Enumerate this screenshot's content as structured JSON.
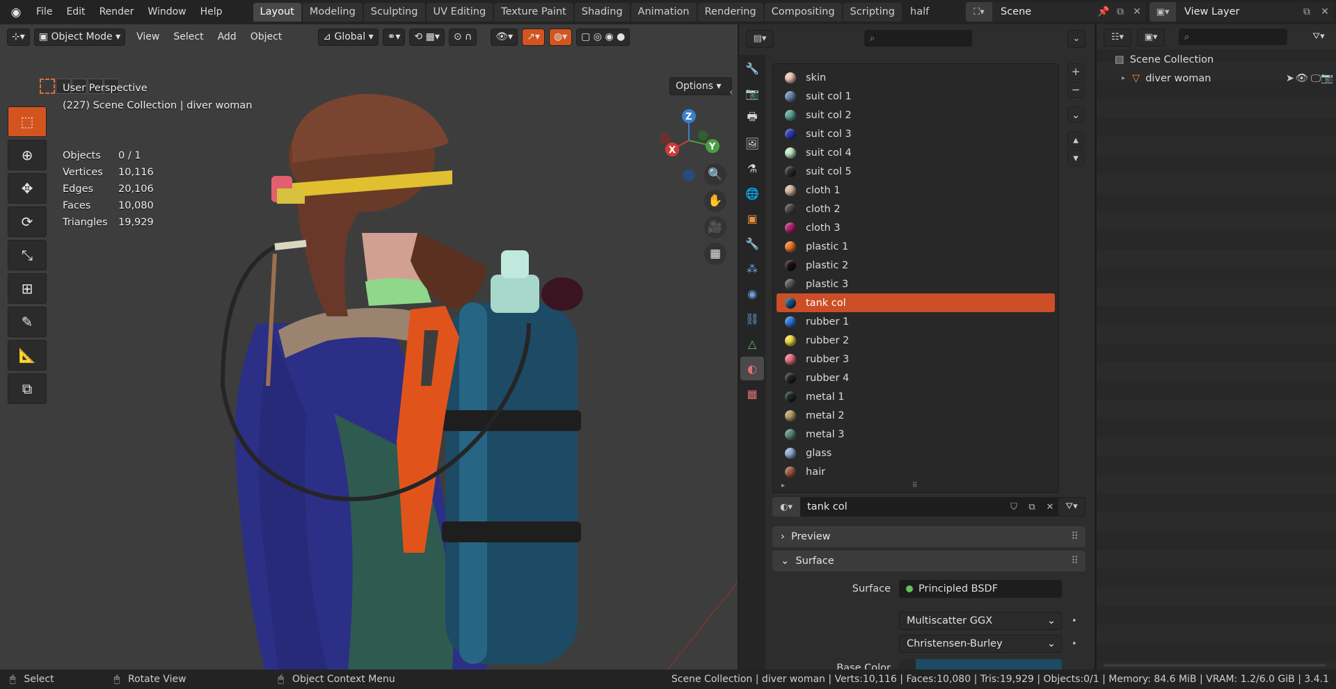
{
  "menu": [
    "File",
    "Edit",
    "Render",
    "Window",
    "Help"
  ],
  "workspaces": [
    "Layout",
    "Modeling",
    "Sculpting",
    "UV Editing",
    "Texture Paint",
    "Shading",
    "Animation",
    "Rendering",
    "Compositing",
    "Scripting",
    "half"
  ],
  "active_workspace": "Layout",
  "scene": {
    "name": "Scene"
  },
  "view_layer": {
    "name": "View Layer"
  },
  "viewport": {
    "mode": "Object Mode",
    "menus": [
      "View",
      "Select",
      "Add",
      "Object"
    ],
    "orientation": "Global",
    "options_label": "Options",
    "view_name": "User Perspective",
    "collection_info": "(227) Scene Collection | diver woman",
    "stats": [
      {
        "label": "Objects",
        "value": "0 / 1"
      },
      {
        "label": "Vertices",
        "value": "10,116"
      },
      {
        "label": "Edges",
        "value": "20,106"
      },
      {
        "label": "Faces",
        "value": "10,080"
      },
      {
        "label": "Triangles",
        "value": "19,929"
      }
    ],
    "gizmo": {
      "x": "X",
      "y": "Y",
      "z": "Z"
    }
  },
  "materials": {
    "slots": [
      {
        "name": "skin",
        "color": "#f0c9b8"
      },
      {
        "name": "suit col 1",
        "color": "#6a87b2"
      },
      {
        "name": "suit col 2",
        "color": "#5aa79a"
      },
      {
        "name": "suit col 3",
        "color": "#2a3bb0"
      },
      {
        "name": "suit col 4",
        "color": "#bfeec8"
      },
      {
        "name": "suit col 5",
        "color": "#2a2a2a"
      },
      {
        "name": "cloth 1",
        "color": "#d8bca0"
      },
      {
        "name": "cloth 2",
        "color": "#444444"
      },
      {
        "name": "cloth 3",
        "color": "#b0206a"
      },
      {
        "name": "plastic 1",
        "color": "#f07a22"
      },
      {
        "name": "plastic 2",
        "color": "#1e1010"
      },
      {
        "name": "plastic 3",
        "color": "#555555"
      },
      {
        "name": "tank col",
        "color": "#1a4f7a"
      },
      {
        "name": "rubber 1",
        "color": "#2a7ae0"
      },
      {
        "name": "rubber 2",
        "color": "#f2e040"
      },
      {
        "name": "rubber 3",
        "color": "#f07080"
      },
      {
        "name": "rubber 4",
        "color": "#222222"
      },
      {
        "name": "metal 1",
        "color": "#1a2a2a"
      },
      {
        "name": "metal 2",
        "color": "#b8a060"
      },
      {
        "name": "metal 3",
        "color": "#5a8a80"
      },
      {
        "name": "glass",
        "color": "#90b0d8"
      },
      {
        "name": "hair",
        "color": "#a05a40"
      }
    ],
    "selected": "tank col",
    "active_name": "tank col",
    "panels": {
      "preview": "Preview",
      "surface": "Surface"
    },
    "surface_label": "Surface",
    "surface_value": "Principled BSDF",
    "distribution": "Multiscatter GGX",
    "subsurface": "Christensen-Burley",
    "base_color_label": "Base Color"
  },
  "outliner": {
    "root": "Scene Collection",
    "items": [
      {
        "name": "diver woman"
      }
    ]
  },
  "statusbar": {
    "left": [
      {
        "label": "Select"
      },
      {
        "label": "Rotate View"
      },
      {
        "label": "Object Context Menu"
      }
    ],
    "right": "Scene Collection | diver woman | Verts:10,116 | Faces:10,080 | Tris:19,929 | Objects:0/1 | Memory: 84.6 MiB | VRAM: 1.2/6.0 GiB | 3.4.1"
  }
}
